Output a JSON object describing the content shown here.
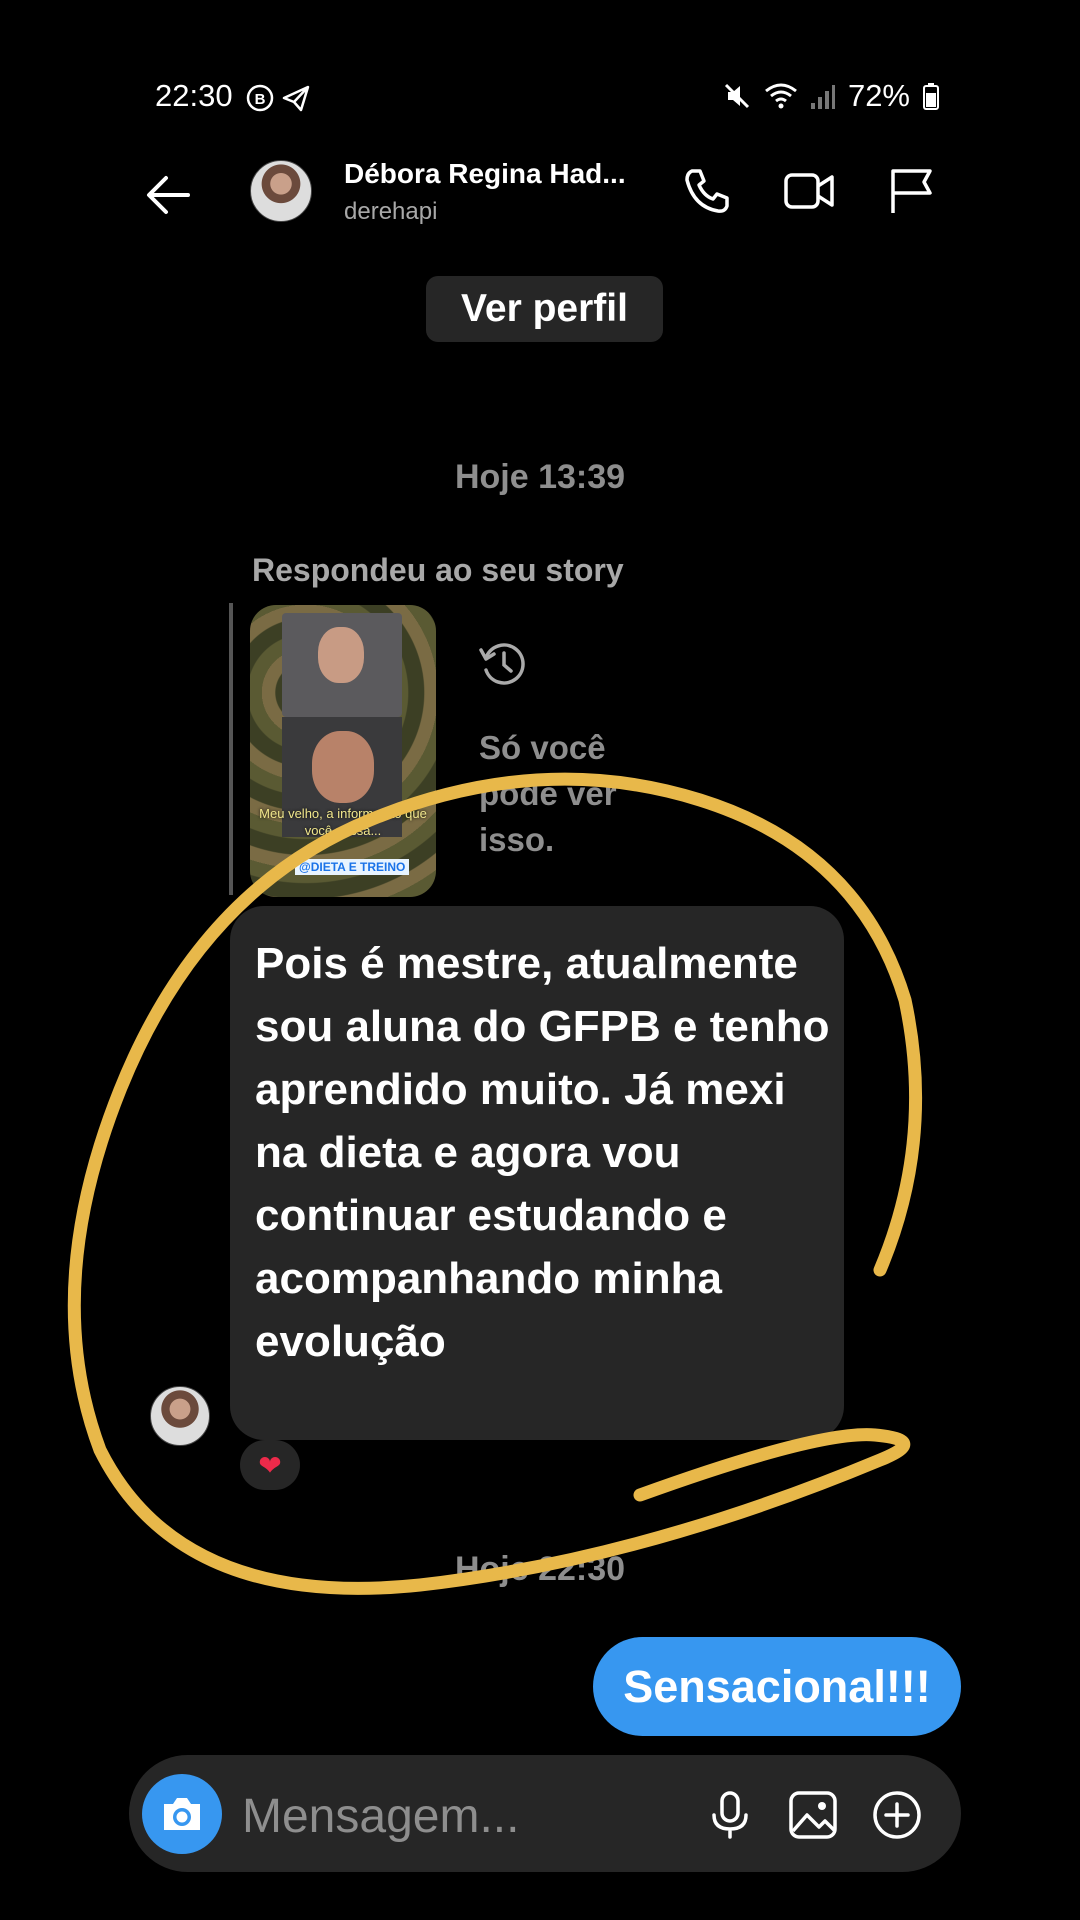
{
  "status_bar": {
    "time": "22:30",
    "battery": "72%"
  },
  "header": {
    "name": "Débora Regina Had...",
    "username": "derehapi"
  },
  "view_profile_label": "Ver perfil",
  "thread": {
    "timestamp_1": "Hoje 13:39",
    "replied_label": "Respondeu ao seu story",
    "story": {
      "caption": "Meu velho, a informação que você passa...",
      "tag": "@DIETA E TREINO"
    },
    "only_you_text": "Só você pode ver isso.",
    "message": "Pois é mestre, atualmente sou aluna do GFPB e tenho aprendido muito. Já mexi na dieta e agora vou continuar estudando e acompanhando minha evolução",
    "reaction": "❤",
    "timestamp_2": "Hoje 22:30",
    "sent_message": "Sensacional!!!"
  },
  "composer": {
    "placeholder": "Mensagem..."
  },
  "colors": {
    "accent": "#3797f0",
    "bubble": "#262626",
    "annotation": "#e8b84a"
  }
}
